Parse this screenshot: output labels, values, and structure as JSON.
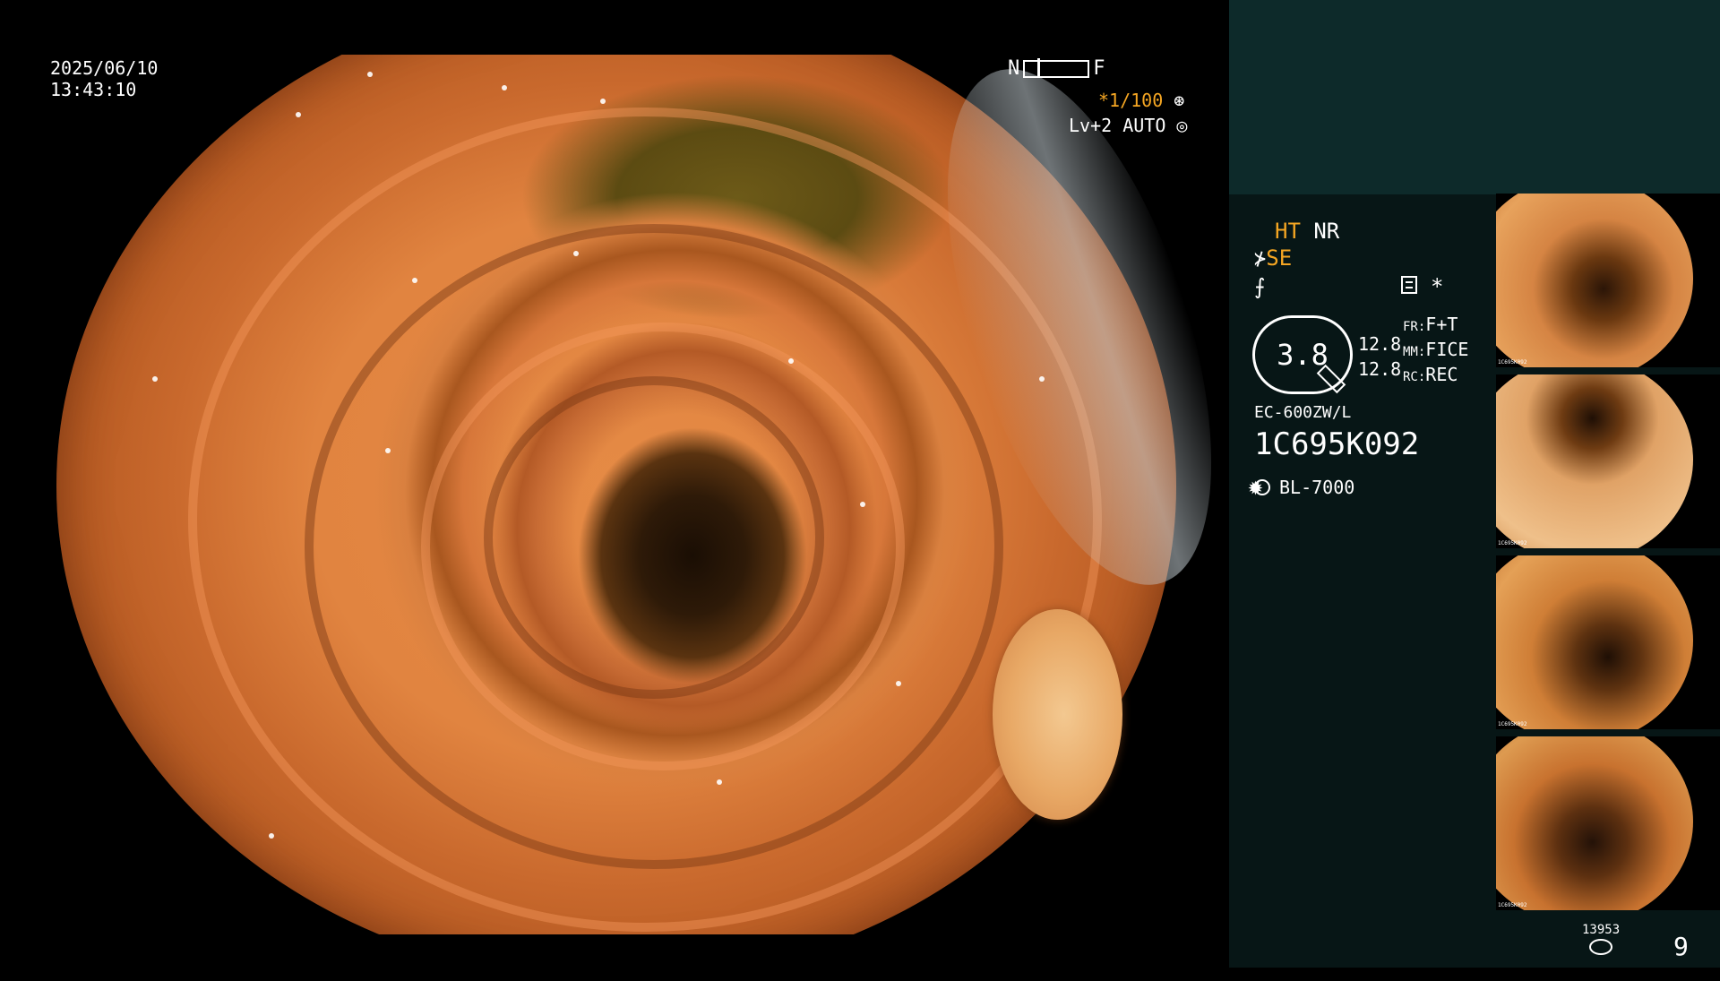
{
  "main": {
    "date": "2025/06/10",
    "time": "13:43:10",
    "nf_left": "N",
    "nf_right": "F",
    "shutter": "*1/100",
    "level": "Lv+2 AUTO"
  },
  "panel": {
    "ht": "HT",
    "nr": "NR",
    "se": "SE",
    "zoom": "3.8",
    "reading_1": "12.8",
    "reading_2": "12.8",
    "fr_key": "FR:",
    "fr_val": "F+T",
    "mm_key": "MM:",
    "mm_val": "FICE",
    "rc_key": "RC:",
    "rc_val": "REC",
    "scope_model": "EC-600ZW/L",
    "scope_serial": "1C695K092",
    "light_source": "BL-7000",
    "image_count_small": "13953",
    "image_count_big": "9"
  },
  "thumbnails": [
    {
      "caption": "1C695K092"
    },
    {
      "caption": "1C695K092"
    },
    {
      "caption": "1C695K092"
    },
    {
      "caption": "1C695K092"
    }
  ],
  "colors": {
    "accent": "#f5a623",
    "panel_top": "#0d2a2a",
    "panel_bottom": "#071616"
  }
}
